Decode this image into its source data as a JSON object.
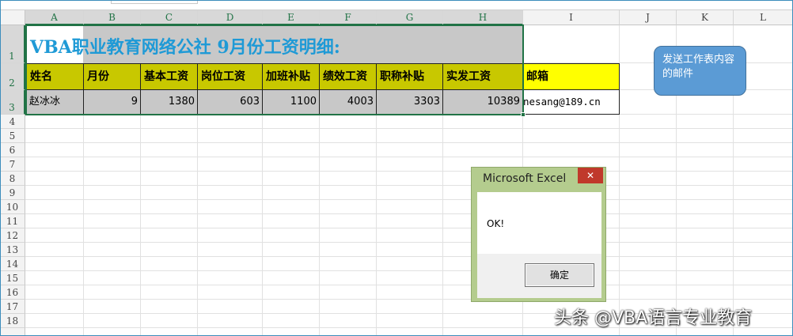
{
  "sheet": {
    "columns": [
      "A",
      "B",
      "C",
      "D",
      "E",
      "F",
      "G",
      "H",
      "I",
      "J",
      "K",
      "L"
    ],
    "rows": [
      "1",
      "2",
      "3",
      "4",
      "5",
      "6",
      "7",
      "8",
      "9",
      "10",
      "11",
      "12",
      "13",
      "14",
      "15",
      "16",
      "17",
      "18"
    ],
    "title": "VBA职业教育网络公社 9月份工资明细:",
    "headers": [
      "姓名",
      "月份",
      "基本工资",
      "岗位工资",
      "加班补贴",
      "绩效工资",
      "职称补贴",
      "实发工资",
      "邮箱"
    ],
    "record": {
      "name": "赵冰冰",
      "values": [
        "9",
        "1380",
        "603",
        "1100",
        "4003",
        "3303",
        "10389"
      ],
      "email": "nesang@189.cn"
    }
  },
  "button": {
    "label": "发送工作表内容的邮件"
  },
  "dialog": {
    "title": "Microsoft Excel",
    "message": "OK!",
    "ok_label": "确定",
    "close_glyph": "✕"
  },
  "watermark": {
    "text": "头条 @VBA语言专业教育"
  },
  "colors": {
    "header_fill": "#c8c800",
    "title_text": "#1f9ad6",
    "email_header_fill": "#ffff00",
    "button_fill": "#5b9bd5",
    "dialog_frame": "#b4cc8e",
    "selection": "#217346"
  }
}
